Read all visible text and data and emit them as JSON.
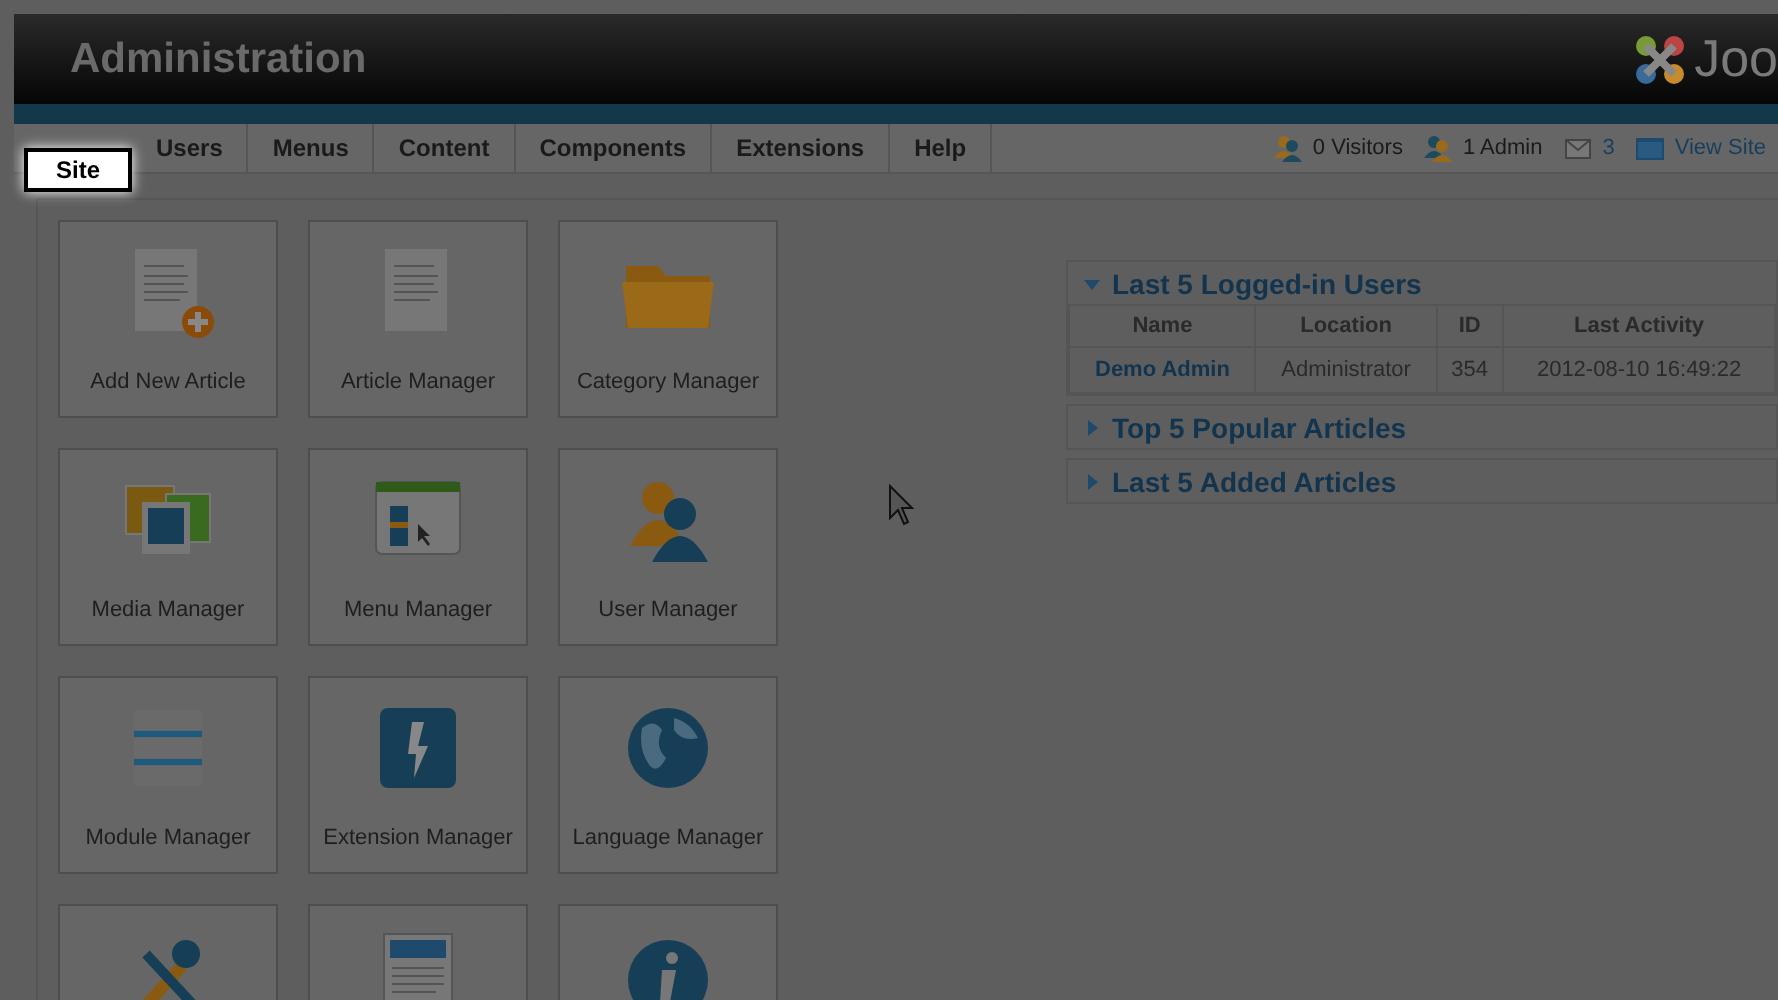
{
  "header": {
    "title": "Administration",
    "logo_text": "Joo"
  },
  "menu": [
    {
      "label": "Site",
      "highlighted": true
    },
    {
      "label": "Users",
      "highlighted": false
    },
    {
      "label": "Menus",
      "highlighted": false
    },
    {
      "label": "Content",
      "highlighted": false
    },
    {
      "label": "Components",
      "highlighted": false
    },
    {
      "label": "Extensions",
      "highlighted": false
    },
    {
      "label": "Help",
      "highlighted": false
    }
  ],
  "status": {
    "visitors": "0 Visitors",
    "admins": "1 Admin",
    "messages": "3",
    "view_site": "View Site"
  },
  "tiles": [
    {
      "label": "Add New Article"
    },
    {
      "label": "Article Manager"
    },
    {
      "label": "Category Manager"
    },
    {
      "label": "Media Manager"
    },
    {
      "label": "Menu Manager"
    },
    {
      "label": "User Manager"
    },
    {
      "label": "Module Manager"
    },
    {
      "label": "Extension Manager"
    },
    {
      "label": "Language Manager"
    },
    {
      "kind": "icon_only"
    },
    {
      "kind": "icon_only"
    },
    {
      "kind": "icon_only"
    }
  ],
  "panels": [
    {
      "title": "Last 5 Logged-in Users",
      "expanded": true,
      "table": {
        "columns": [
          "Name",
          "Location",
          "ID",
          "Last Activity"
        ],
        "rows": [
          [
            "Demo Admin",
            "Administrator",
            "354",
            "2012-08-10 16:49:22"
          ]
        ]
      }
    },
    {
      "title": "Top 5 Popular Articles",
      "expanded": false
    },
    {
      "title": "Last 5 Added Articles",
      "expanded": false
    }
  ]
}
